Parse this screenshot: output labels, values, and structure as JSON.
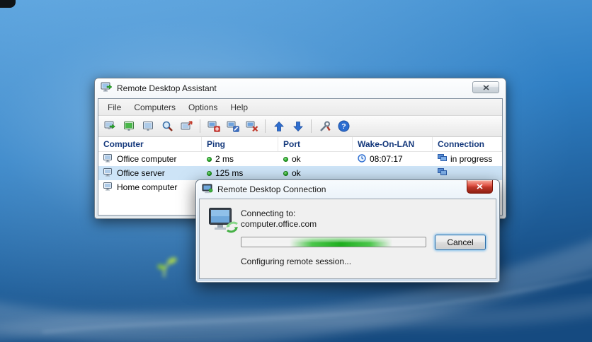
{
  "main_window": {
    "title": "Remote Desktop Assistant",
    "menu": [
      "File",
      "Computers",
      "Options",
      "Help"
    ],
    "toolbar": {
      "icons": [
        "connect",
        "connect-green",
        "view-computer",
        "search",
        "send-link",
        "add-computer",
        "edit-computer",
        "delete-computer",
        "move-up",
        "move-down",
        "settings",
        "help"
      ],
      "help_glyph": "?"
    },
    "table": {
      "columns": [
        "Computer",
        "Ping",
        "Port",
        "Wake-On-LAN",
        "Connection"
      ],
      "rows": [
        {
          "computer": "Office computer",
          "ping": "2 ms",
          "port": "ok",
          "wol": "08:07:17",
          "connection": "in progress"
        },
        {
          "computer": "Office server",
          "ping": "125 ms",
          "port": "ok",
          "wol": "",
          "connection": ""
        },
        {
          "computer": "Home computer",
          "ping": "",
          "port": "",
          "wol": "",
          "connection": ""
        }
      ]
    }
  },
  "dialog": {
    "title": "Remote Desktop Connection",
    "connecting_label": "Connecting to:",
    "host": "computer.office.com",
    "cancel_label": "Cancel",
    "status": "Configuring remote session..."
  },
  "colors": {
    "selection": "#cde4f7",
    "header_text": "#15397c",
    "progress_green": "#1fae1f",
    "close_button_red": "#c0392b",
    "desktop_blue": "#2f7fc4"
  }
}
